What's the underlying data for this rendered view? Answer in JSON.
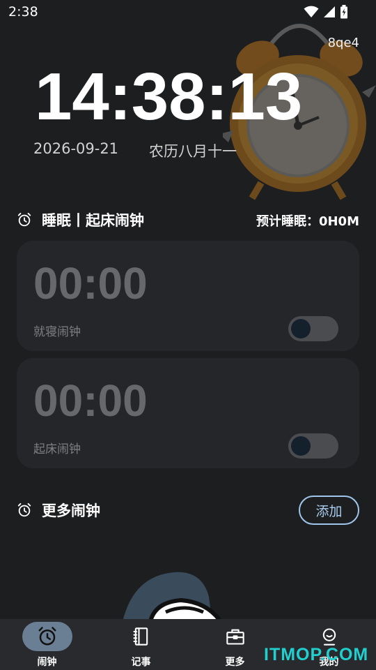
{
  "status_bar": {
    "time": "2:38"
  },
  "header": {
    "device_id": "8qe4",
    "clock": "14:38:13",
    "date": "2026-09-21",
    "lunar_date": "农历八月十一"
  },
  "sleep_section": {
    "title": "睡眠丨起床闹钟",
    "estimate": "预计睡眠：0H0M"
  },
  "alarms": [
    {
      "time": "00:00",
      "label": "就寝闹钟",
      "enabled": false
    },
    {
      "time": "00:00",
      "label": "起床闹钟",
      "enabled": false
    }
  ],
  "more_section": {
    "title": "更多闹钟",
    "add_label": "添加"
  },
  "nav": {
    "items": [
      {
        "label": "闹钟",
        "icon": "alarm-clock-icon",
        "active": true
      },
      {
        "label": "记事",
        "icon": "notebook-icon",
        "active": false
      },
      {
        "label": "更多",
        "icon": "toolbox-icon",
        "active": false
      },
      {
        "label": "我的",
        "icon": "profile-icon",
        "active": false
      }
    ]
  },
  "watermark": "ITMOP.COM",
  "colors": {
    "background": "#1d1e20",
    "card": "#252629",
    "accent": "#9fc6ec",
    "nav_active": "#6b7f94",
    "watermark": "#22cfcf"
  }
}
